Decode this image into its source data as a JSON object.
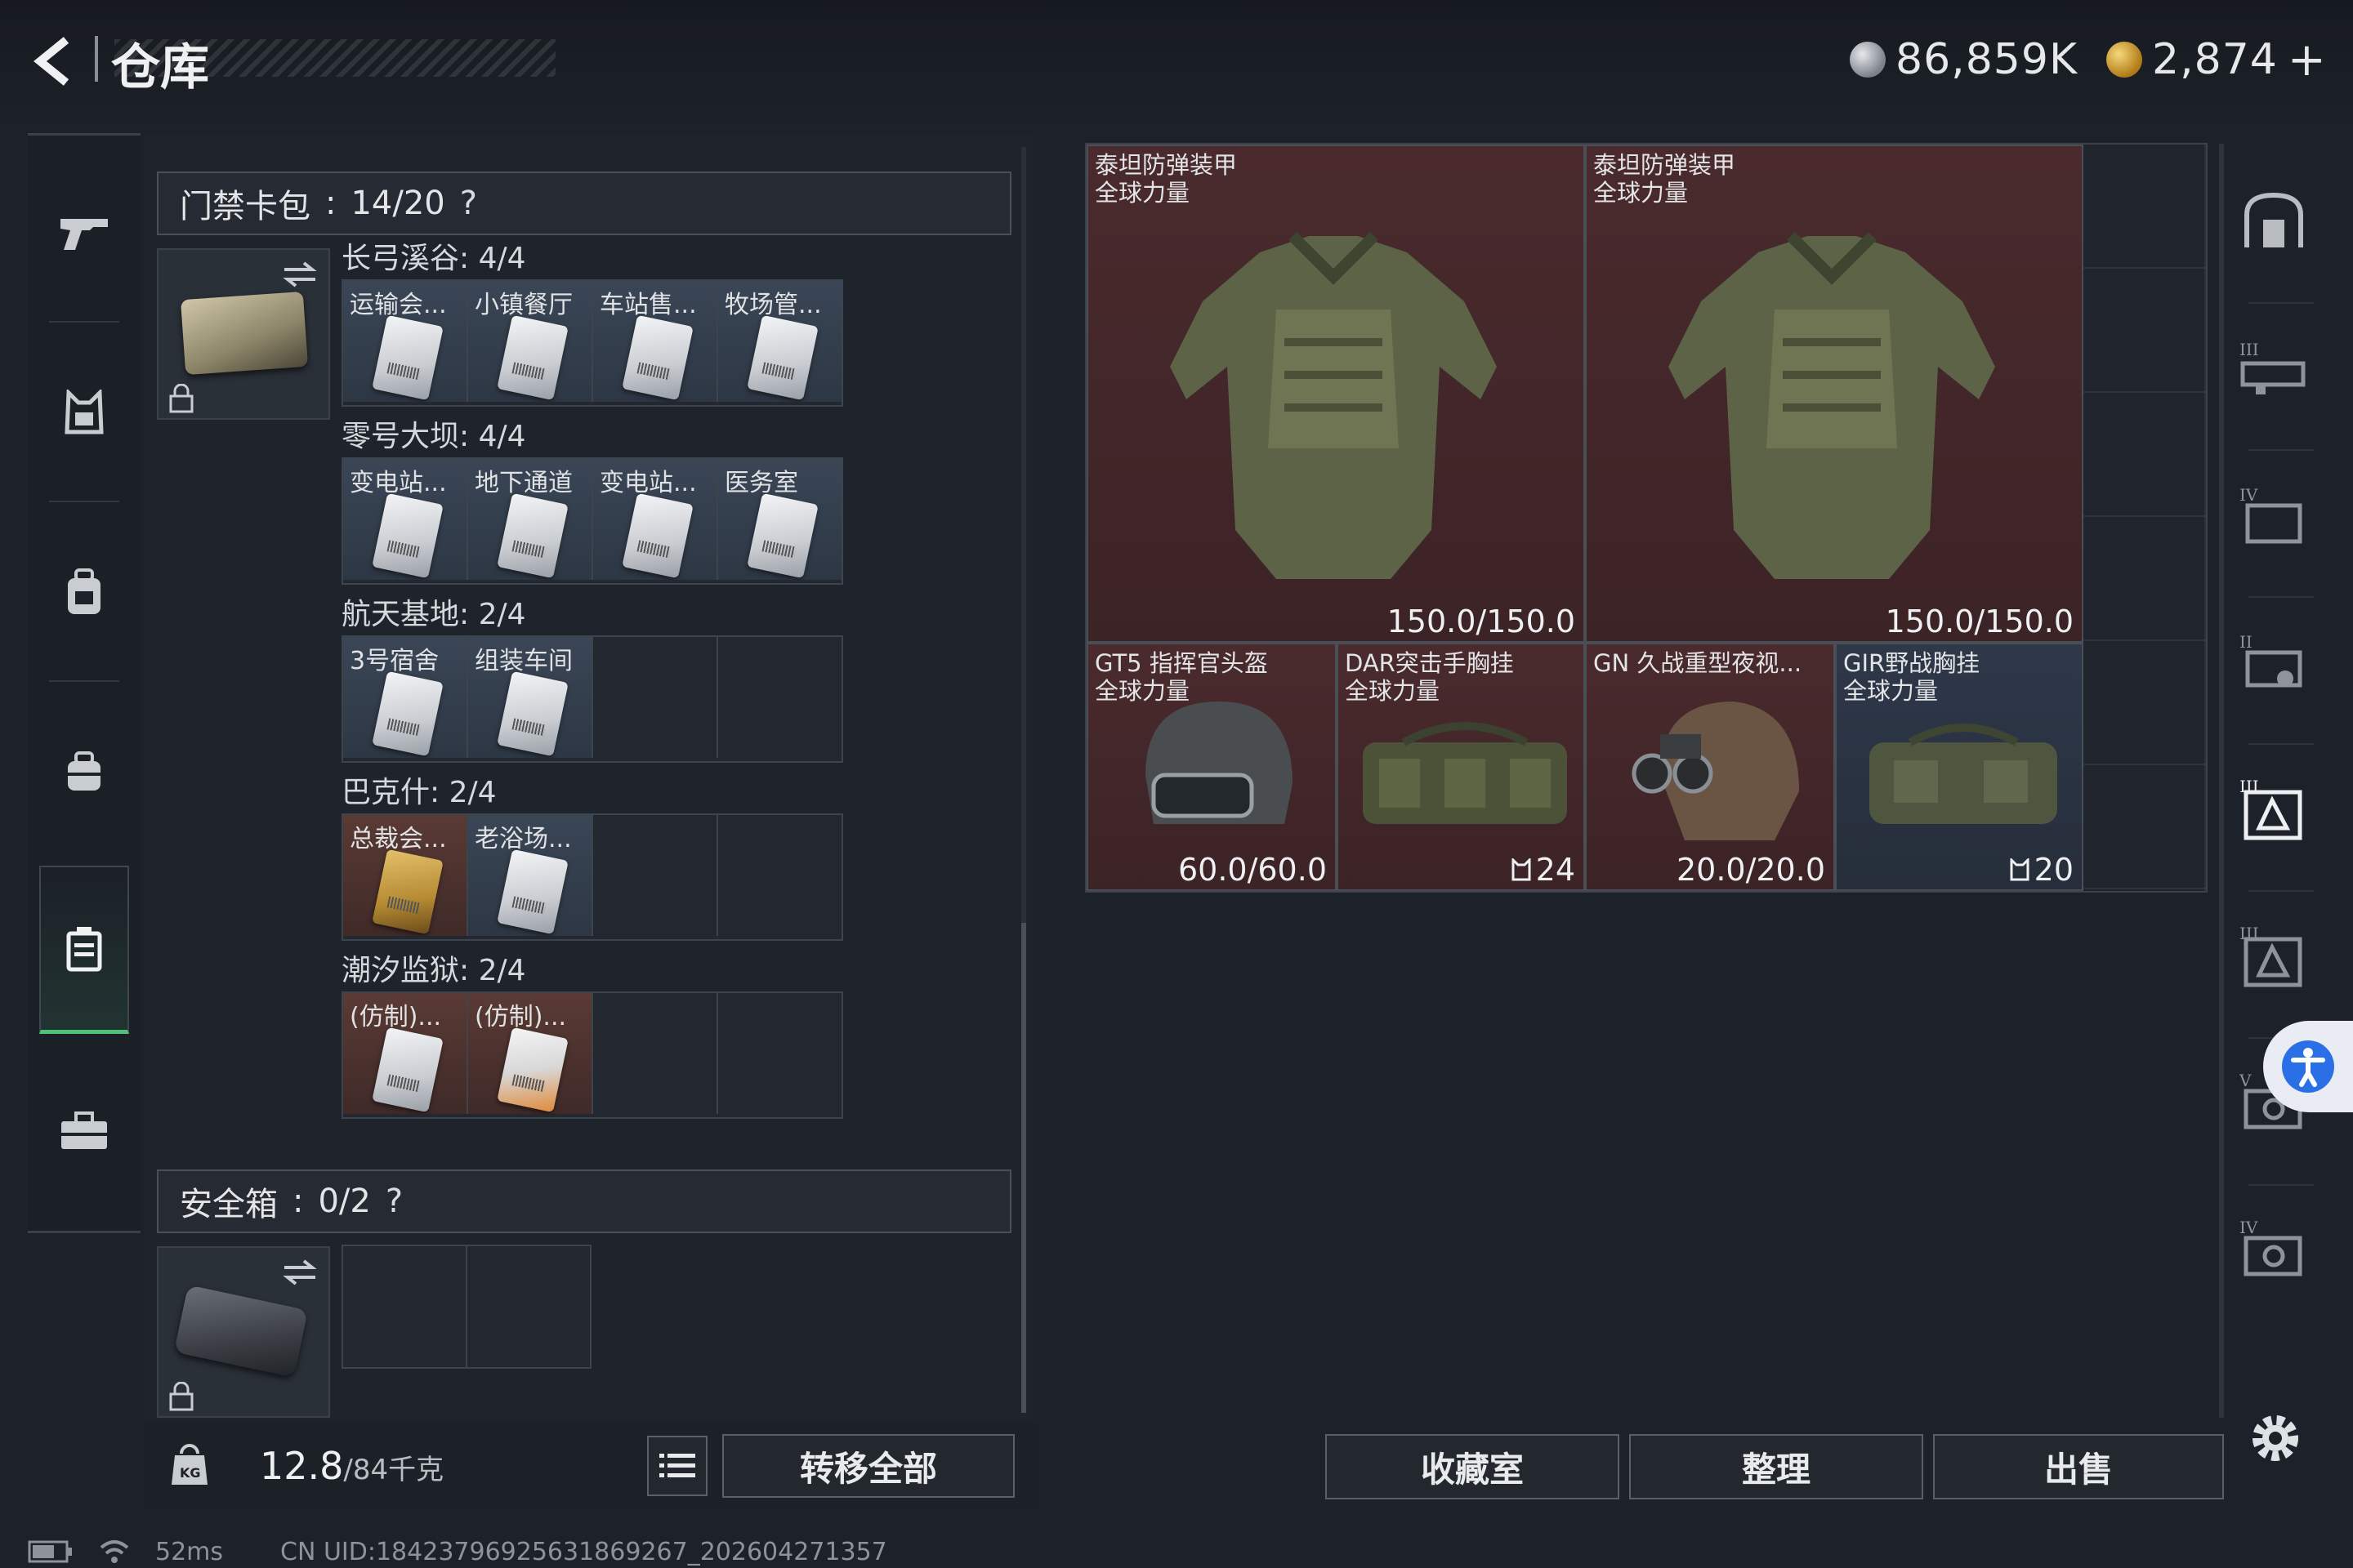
{
  "header": {
    "title": "仓库",
    "currency_silver": "86,859K",
    "currency_gold": "2,874",
    "add_symbol": "+"
  },
  "left_nav": {
    "items": [
      "weapon-icon",
      "armor-icon",
      "backpack-icon",
      "bag-icon",
      "keycard-case-icon",
      "briefcase-icon"
    ],
    "active_index": 4
  },
  "keycard_section": {
    "title": "门禁卡包",
    "count": "14/20",
    "help": "?",
    "groups": [
      {
        "label": "长弓溪谷: 4/4",
        "slots": [
          "运输会...",
          "小镇餐厅",
          "车站售...",
          "牧场管..."
        ]
      },
      {
        "label": "零号大坝: 4/4",
        "slots": [
          "变电站...",
          "地下通道",
          "变电站...",
          "医务室"
        ]
      },
      {
        "label": "航天基地: 2/4",
        "slots": [
          "3号宿舍",
          "组装车间"
        ]
      },
      {
        "label": "巴克什: 2/4",
        "slots": [
          "总裁会...",
          "老浴场..."
        ]
      },
      {
        "label": "潮汐监狱: 2/4",
        "slots": [
          "(仿制)...",
          "(仿制)..."
        ]
      }
    ]
  },
  "safe_section": {
    "title": "安全箱",
    "count": "0/2",
    "help": "?"
  },
  "footer_left": {
    "weight_current": "12.8",
    "weight_max": "/84千克",
    "transfer_all": "转移全部",
    "kg_badge": "KG"
  },
  "stash_items": [
    {
      "name": "泰坦防弹装甲",
      "sub": "全球力量",
      "value": "150.0/150.0",
      "rarity": "red"
    },
    {
      "name": "泰坦防弹装甲",
      "sub": "全球力量",
      "value": "150.0/150.0",
      "rarity": "red"
    },
    {
      "name": "GT5 指挥官头盔",
      "sub": "全球力量",
      "value": "60.0/60.0",
      "rarity": "red"
    },
    {
      "name": "DAR突击手胸挂",
      "sub": "全球力量",
      "value": "24",
      "rarity": "red"
    },
    {
      "name": "GN 久战重型夜视...",
      "sub": "",
      "value": "20.0/20.0",
      "rarity": "red"
    },
    {
      "name": "GIR野战胸挂",
      "sub": "全球力量",
      "value": "20",
      "rarity": "blue"
    }
  ],
  "footer_right": {
    "collection": "收藏室",
    "organize": "整理",
    "sell": "出售"
  },
  "right_nav": {
    "tiers": [
      "",
      "III",
      "IV",
      "II",
      "",
      "III",
      "V",
      "IV"
    ]
  },
  "status": {
    "ping": "52ms",
    "uid": "CN UID:18423796925631869267_202604271357"
  },
  "colors": {
    "accent_green": "#4fbf7a",
    "rarity_red": "#4a2a2d",
    "rarity_blue": "#2e3849",
    "access_blue": "#2b6fe6"
  }
}
